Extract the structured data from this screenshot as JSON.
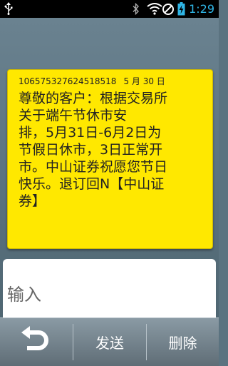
{
  "status_bar": {
    "usb_icon": "usb-icon",
    "bluetooth_icon": "bluetooth-icon",
    "wifi_icon": "wifi-icon",
    "signal_icon": "no-signal-icon",
    "battery_icon": "battery-charging-icon",
    "time": "1:29"
  },
  "message": {
    "sender": "106575327624518518",
    "date": "5 月 30 日",
    "body": "尊敬的客户：根据交易所\n关于端午节休市安\n排，5月31日-6月2日为\n节假日休市，3日正常开\n市。中山证券祝愿您节日\n快乐。退订回N【中山证\n券】",
    "card_color": "#ffe800"
  },
  "compose": {
    "placeholder": "输入"
  },
  "bottom_bar": {
    "back_icon": "back-arrow-icon",
    "send_label": "发送",
    "delete_label": "删除"
  }
}
